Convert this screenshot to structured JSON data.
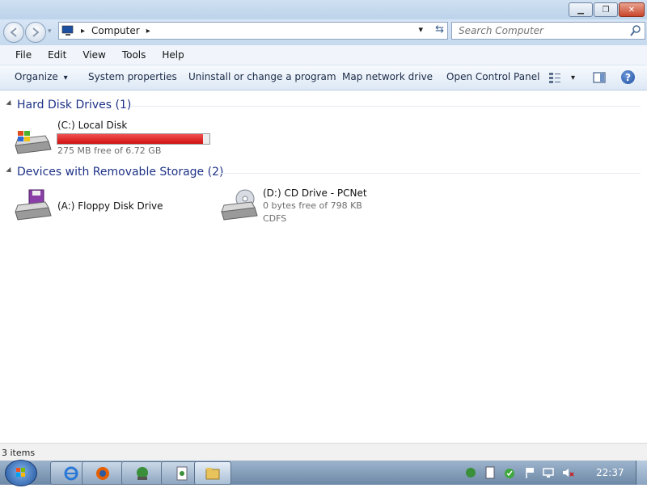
{
  "window": {
    "minimize_glyph": "▁",
    "maximize_glyph": "❐",
    "close_glyph": "✕"
  },
  "address_bar": {
    "crumb": "Computer",
    "sep1": "▸",
    "sep2": "▸",
    "dropdown": "▾",
    "refresh_glyph": "⇆"
  },
  "search": {
    "placeholder": "Search Computer"
  },
  "menu": {
    "file": "File",
    "edit": "Edit",
    "view": "View",
    "tools": "Tools",
    "help": "Help"
  },
  "toolbar": {
    "organize": "Organize",
    "organize_arrow": "▾",
    "system_properties": "System properties",
    "uninstall": "Uninstall or change a program",
    "map_drive": "Map network drive",
    "control_panel": "Open Control Panel",
    "views_arrow": "▾",
    "help_glyph": "?"
  },
  "groups": {
    "hard_disk": {
      "title": "Hard Disk Drives (1)",
      "items": [
        {
          "name": "(C:) Local Disk",
          "free": "275 MB free of 6.72 GB",
          "used_fraction": 0.96
        }
      ]
    },
    "removable": {
      "title": "Devices with Removable Storage (2)",
      "items": [
        {
          "name": "(A:) Floppy Disk Drive"
        },
        {
          "name": "(D:) CD Drive - PCNet",
          "free": "0 bytes free of 798 KB",
          "fs": "CDFS"
        }
      ]
    }
  },
  "status": {
    "items": "3 items"
  },
  "taskbar": {
    "clock": "22:37"
  },
  "colors": {
    "header_text": "#1e3287",
    "drive_bar_fill": "#e01b1b"
  },
  "icons": {
    "back": "back-arrow-icon",
    "forward": "forward-arrow-icon",
    "computer": "computer-icon",
    "search": "search-icon",
    "hdd": "hard-drive-icon",
    "floppy": "floppy-drive-icon",
    "cd": "cd-drive-icon",
    "ie": "internet-explorer-icon",
    "firefox": "firefox-icon",
    "network": "network-icon",
    "document": "document-icon",
    "folder": "folder-icon"
  }
}
